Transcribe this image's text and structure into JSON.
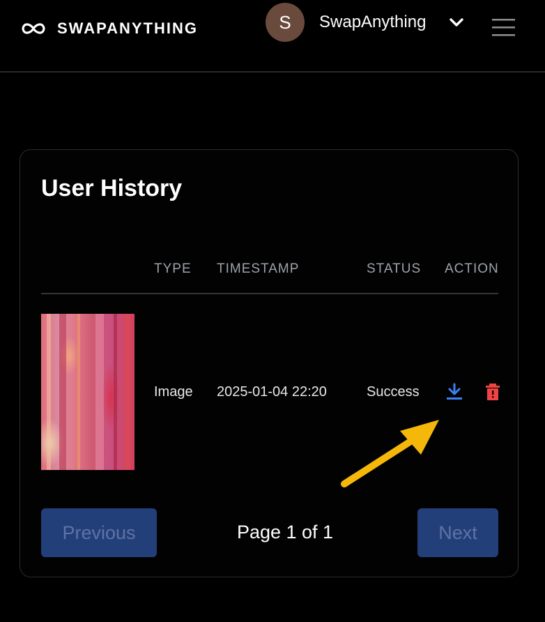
{
  "header": {
    "logo_text": "SWAPANYTHING",
    "avatar_initial": "S",
    "user_name": "SwapAnything"
  },
  "history": {
    "title": "User History",
    "columns": [
      "TYPE",
      "TIMESTAMP",
      "STATUS",
      "ACTION"
    ],
    "rows": [
      {
        "type": "Image",
        "timestamp": "2025-01-04 22:20",
        "status": "Success"
      }
    ]
  },
  "pagination": {
    "previous_label": "Previous",
    "page_info": "Page 1 of 1",
    "next_label": "Next"
  },
  "colors": {
    "download_icon": "#3b82f6",
    "delete_icon": "#ef4444",
    "button_bg": "#233f7a",
    "annotation_arrow": "#f5b80a"
  },
  "icons": [
    "infinity-logo-icon",
    "chevron-down-icon",
    "hamburger-menu-icon",
    "download-icon",
    "trash-icon",
    "annotation-arrow"
  ]
}
